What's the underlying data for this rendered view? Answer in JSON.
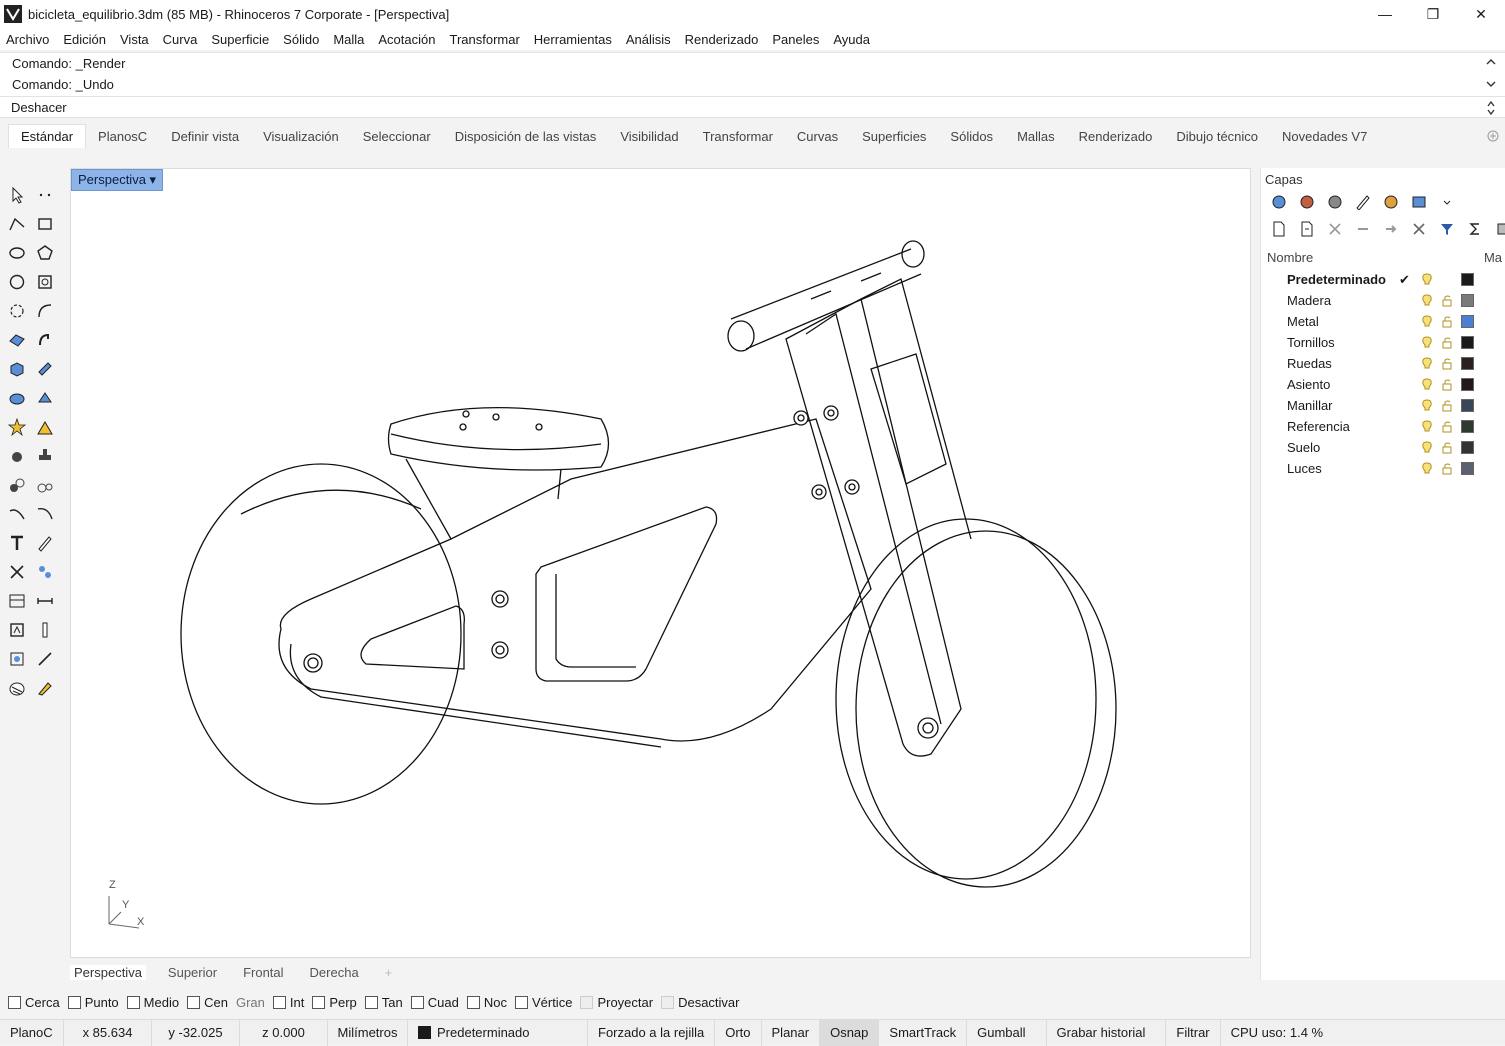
{
  "window": {
    "title": "bicicleta_equilibrio.3dm (85 MB) - Rhinoceros 7 Corporate - [Perspectiva]",
    "minimize": "—",
    "maximize": "❐",
    "close": "✕"
  },
  "menu": [
    "Archivo",
    "Edición",
    "Vista",
    "Curva",
    "Superficie",
    "Sólido",
    "Malla",
    "Acotación",
    "Transformar",
    "Herramientas",
    "Análisis",
    "Renderizado",
    "Paneles",
    "Ayuda"
  ],
  "command_history": [
    "Comando: _Render",
    "Comando: _Undo"
  ],
  "command_prompt": "Deshacer",
  "toolbar_tabs": [
    "Estándar",
    "PlanosC",
    "Definir vista",
    "Visualización",
    "Seleccionar",
    "Disposición de las vistas",
    "Visibilidad",
    "Transformar",
    "Curvas",
    "Superficies",
    "Sólidos",
    "Mallas",
    "Renderizado",
    "Dibujo técnico",
    "Novedades V7"
  ],
  "active_toolbar_tab": "Estándar",
  "viewport": {
    "label": "Perspectiva",
    "axis_labels": {
      "z": "Z",
      "y": "Y",
      "x": "X"
    }
  },
  "view_tabs": [
    "Perspectiva",
    "Superior",
    "Frontal",
    "Derecha",
    "+"
  ],
  "layers_panel": {
    "title": "Capas",
    "col_name": "Nombre",
    "col_mat": "Ma",
    "layers": [
      {
        "name": "Predeterminado",
        "current": true,
        "color": "#1a1a1a"
      },
      {
        "name": "Madera",
        "current": false,
        "color": "#7a7a7a"
      },
      {
        "name": "Metal",
        "current": false,
        "color": "#4a7fd4"
      },
      {
        "name": "Tornillos",
        "current": false,
        "color": "#1a1a1a"
      },
      {
        "name": "Ruedas",
        "current": false,
        "color": "#2a2020"
      },
      {
        "name": "Asiento",
        "current": false,
        "color": "#20181a"
      },
      {
        "name": "Manillar",
        "current": false,
        "color": "#3a4658"
      },
      {
        "name": "Referencia",
        "current": false,
        "color": "#2c3a30"
      },
      {
        "name": "Suelo",
        "current": false,
        "color": "#333333"
      },
      {
        "name": "Luces",
        "current": false,
        "color": "#5a6070"
      }
    ]
  },
  "osnaps": [
    {
      "label": "Cerca"
    },
    {
      "label": "Punto"
    },
    {
      "label": "Medio"
    },
    {
      "label": "Cen"
    },
    {
      "label": "Gran"
    },
    {
      "label": "Int"
    },
    {
      "label": "Perp"
    },
    {
      "label": "Tan"
    },
    {
      "label": "Cuad"
    },
    {
      "label": "Noc"
    },
    {
      "label": "Vértice"
    },
    {
      "label": "Proyectar"
    },
    {
      "label": "Desactivar"
    }
  ],
  "status": {
    "cplane": "PlanoC",
    "x": "x 85.634",
    "y": "y -32.025",
    "z": "z 0.000",
    "units": "Milímetros",
    "layer": "Predeterminado",
    "grid_snap": "Forzado a la rejilla",
    "ortho": "Orto",
    "planar": "Planar",
    "osnap": "Osnap",
    "smarttrack": "SmartTrack",
    "gumball": "Gumball",
    "history": "Grabar historial",
    "filter": "Filtrar",
    "cpu": "CPU uso: 1.4 %"
  }
}
